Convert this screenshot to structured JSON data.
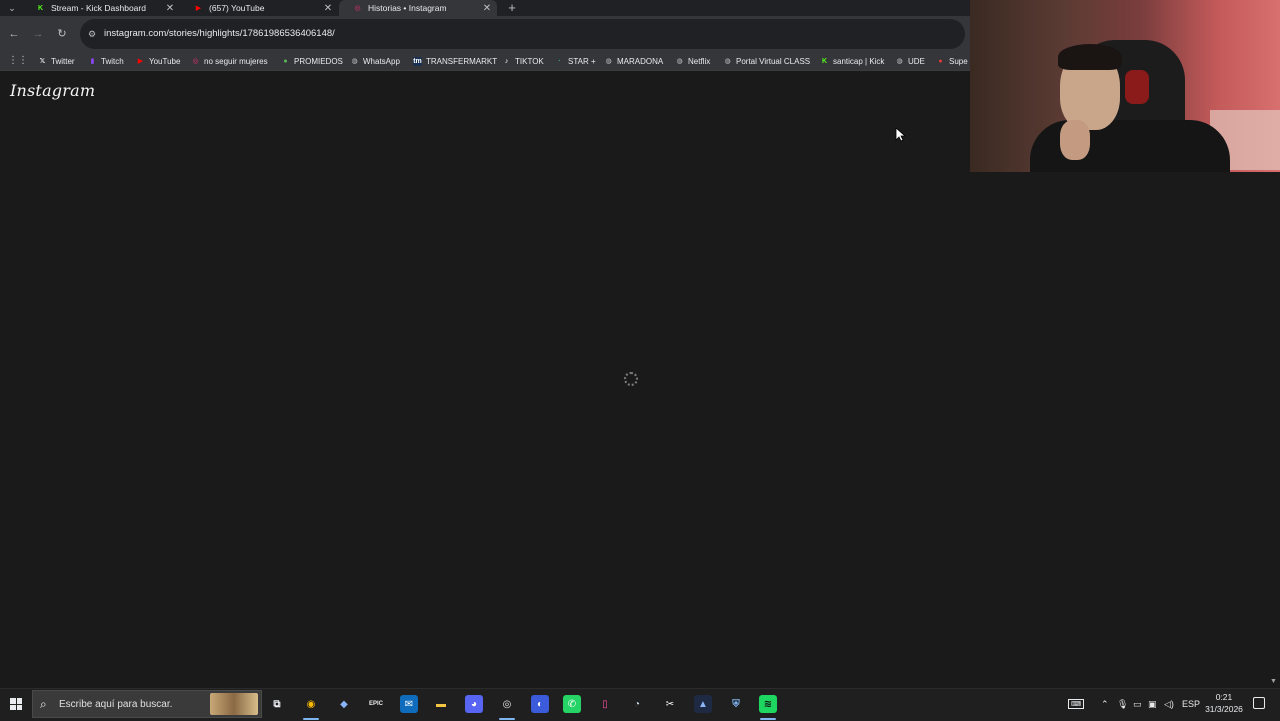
{
  "tabs": [
    {
      "title": "Stream - Kick Dashboard",
      "favicon": "kick-icon",
      "color": "#53fc18",
      "active": false
    },
    {
      "title": "(657) YouTube",
      "favicon": "youtube-icon",
      "color": "#ff0000",
      "active": false
    },
    {
      "title": "Historias • Instagram",
      "favicon": "instagram-icon",
      "color": "#e1306c",
      "active": true
    }
  ],
  "toolbar": {
    "url": "instagram.com/stories/highlights/17861986536406148/"
  },
  "bookmarks": [
    {
      "label": "Twitter",
      "icon": "x-icon",
      "glyph": "𝕏",
      "color": "#ffffff",
      "bg": "transparent"
    },
    {
      "label": "Twitch",
      "icon": "twitch-icon",
      "glyph": "▮",
      "color": "#9146ff",
      "bg": "transparent"
    },
    {
      "label": "YouTube",
      "icon": "youtube-icon",
      "glyph": "▶",
      "color": "#ff0000",
      "bg": "transparent"
    },
    {
      "label": "no seguir mujeres",
      "icon": "instagram-icon",
      "glyph": "◎",
      "color": "#e1306c",
      "bg": "transparent"
    },
    {
      "label": "PROMIEDOS",
      "icon": "promiedos-icon",
      "glyph": "●",
      "color": "#5cb85c",
      "bg": "transparent"
    },
    {
      "label": "WhatsApp",
      "icon": "globe-icon",
      "glyph": "◍",
      "color": "#bdc1c6",
      "bg": "transparent"
    },
    {
      "label": "TRANSFERMARKT",
      "icon": "transfermarkt-icon",
      "glyph": "tm",
      "color": "#ffffff",
      "bg": "#1a3151"
    },
    {
      "label": "TIKTOK",
      "icon": "tiktok-icon",
      "glyph": "♪",
      "color": "#ffffff",
      "bg": "transparent"
    },
    {
      "label": "STAR +",
      "icon": "star-plus-icon",
      "glyph": "·",
      "color": "#2bb3a3",
      "bg": "transparent"
    },
    {
      "label": "MARADONA",
      "icon": "globe-icon",
      "glyph": "◍",
      "color": "#bdc1c6",
      "bg": "transparent"
    },
    {
      "label": "Netflix",
      "icon": "globe-icon",
      "glyph": "◍",
      "color": "#bdc1c6",
      "bg": "transparent"
    },
    {
      "label": "Portal Virtual CLASS",
      "icon": "globe-icon",
      "glyph": "◍",
      "color": "#bdc1c6",
      "bg": "transparent"
    },
    {
      "label": "santicap | Kick",
      "icon": "kick-icon",
      "glyph": "K",
      "color": "#53fc18",
      "bg": "transparent"
    },
    {
      "label": "UDE",
      "icon": "globe-icon",
      "glyph": "◍",
      "color": "#bdc1c6",
      "bg": "transparent"
    },
    {
      "label": "Supe",
      "icon": "supercell-icon",
      "glyph": "●",
      "color": "#e53935",
      "bg": "transparent"
    }
  ],
  "page": {
    "logo": "Instagram"
  },
  "taskbar": {
    "search_placeholder": "Escribe aquí para buscar.",
    "apps": [
      {
        "name": "task-view-icon",
        "glyph": "⧉",
        "color": "#e8eaed",
        "bg": "transparent"
      },
      {
        "name": "chrome-icon",
        "glyph": "◉",
        "color": "#fbbc04",
        "bg": "transparent",
        "active": true
      },
      {
        "name": "copilot-icon",
        "glyph": "◆",
        "color": "#8ab4f8",
        "bg": "transparent"
      },
      {
        "name": "epic-games-icon",
        "glyph": "EPIC",
        "color": "#e8eaed",
        "bg": "transparent"
      },
      {
        "name": "outlook-icon",
        "glyph": "✉",
        "color": "#ffffff",
        "bg": "#0f6cbd"
      },
      {
        "name": "file-explorer-icon",
        "glyph": "▬",
        "color": "#f4c542",
        "bg": "transparent"
      },
      {
        "name": "discord-icon",
        "glyph": "◕",
        "color": "#ffffff",
        "bg": "#5865f2"
      },
      {
        "name": "obs-icon",
        "glyph": "◎",
        "color": "#e8eaed",
        "bg": "transparent",
        "active": true
      },
      {
        "name": "app-blue-icon",
        "glyph": "◐",
        "color": "#ffffff",
        "bg": "#3b5bdb"
      },
      {
        "name": "whatsapp-icon",
        "glyph": "✆",
        "color": "#ffffff",
        "bg": "#25d366"
      },
      {
        "name": "app-pink-icon",
        "glyph": "▯",
        "color": "#ff4fa3",
        "bg": "transparent"
      },
      {
        "name": "steam-icon",
        "glyph": "◔",
        "color": "#c7d5e0",
        "bg": "transparent"
      },
      {
        "name": "capcut-icon",
        "glyph": "✂",
        "color": "#ffffff",
        "bg": "transparent"
      },
      {
        "name": "app-dark-icon",
        "glyph": "▲",
        "color": "#8ab4f8",
        "bg": "#1e2a44"
      },
      {
        "name": "shield-icon",
        "glyph": "⛨",
        "color": "#7fb6f0",
        "bg": "transparent"
      },
      {
        "name": "spotify-icon",
        "glyph": "≋",
        "color": "#111111",
        "bg": "#1ed760",
        "active": true
      }
    ],
    "lang": "ESP",
    "time": "0:21",
    "date": "31/3/2026"
  }
}
